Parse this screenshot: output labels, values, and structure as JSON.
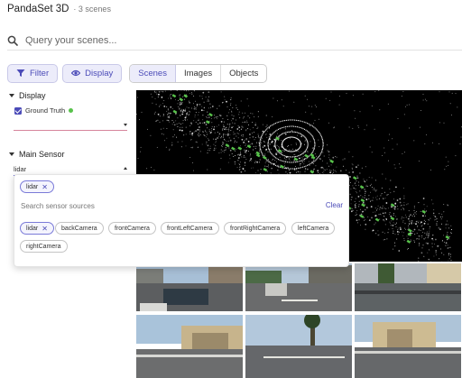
{
  "app": {
    "title": "PandaSet 3D",
    "scene_count": "· 3 scenes"
  },
  "search": {
    "placeholder": "Query your scenes..."
  },
  "toolbar": {
    "filter_label": "Filter",
    "display_label": "Display",
    "tabs": [
      {
        "label": "Scenes",
        "active": true
      },
      {
        "label": "Images",
        "active": false
      },
      {
        "label": "Objects",
        "active": false
      }
    ]
  },
  "sidebar": {
    "display": {
      "header": "Display",
      "ground_truth_label": "Ground Truth",
      "ground_truth_checked": true,
      "ground_truth_color": "#58c24b"
    },
    "main_sensor": {
      "header": "Main Sensor",
      "value": "lidar"
    }
  },
  "sensor_dropdown": {
    "selected": [
      "lidar"
    ],
    "search_placeholder": "Search sensor sources",
    "clear_label": "Clear",
    "options": [
      {
        "label": "lidar",
        "selected": true
      },
      {
        "label": "backCamera",
        "selected": false
      },
      {
        "label": "frontCamera",
        "selected": false
      },
      {
        "label": "frontLeftCamera",
        "selected": false
      },
      {
        "label": "frontRightCamera",
        "selected": false
      },
      {
        "label": "leftCamera",
        "selected": false
      },
      {
        "label": "rightCamera",
        "selected": false
      }
    ]
  },
  "colors": {
    "accent": "#4b4bb8",
    "accent_bg": "#ececfa",
    "annotation_green": "#58c24b"
  },
  "icons": {
    "search": "search-icon",
    "filter": "filter-icon",
    "display": "eye-icon"
  }
}
